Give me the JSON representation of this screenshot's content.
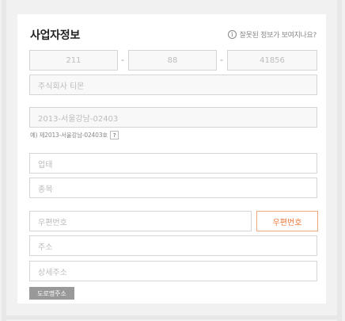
{
  "section": {
    "title": "사업자정보",
    "help_icon": "info-circle-icon",
    "help_text": "잘못된 정보가 보여지나요?"
  },
  "business_number": {
    "part1": "211",
    "part2": "88",
    "part3": "41856",
    "separator": "-"
  },
  "company_name": "주식회사 티몬",
  "registration_number": "2013-서울강남-02403",
  "registration_hint": {
    "text": "예) 제2013-서울강남-02403호",
    "help_mark": "?"
  },
  "business_type_placeholder": "업태",
  "business_item_placeholder": "종목",
  "address": {
    "zip_placeholder": "우편번호",
    "zip_button": "우편번호",
    "address_placeholder": "주소",
    "detail_placeholder": "상세주소",
    "road_button": "도로명주소"
  },
  "colors": {
    "accent": "#e9783b",
    "accent_border": "#f0a77d",
    "input_border": "#d5d5d5",
    "background": "#f1f1f1"
  }
}
